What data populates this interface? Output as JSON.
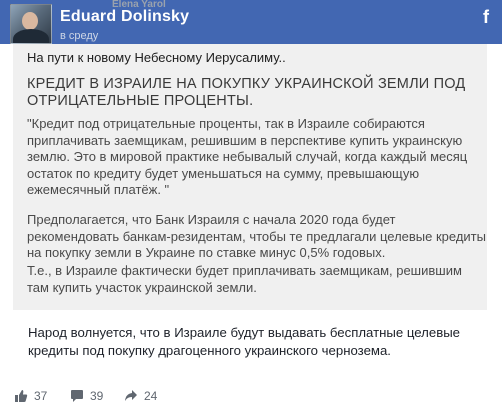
{
  "header": {
    "poster_name": "Eduard Dolinsky",
    "underlying_name": "Elena Yarol",
    "underlying_time": "в среду"
  },
  "shared": {
    "intro": "На пути к новому Небесному Иерусалиму..",
    "heading": "КРЕДИТ В ИЗРАИЛЕ НА ПОКУПКУ УКРАИНСКОЙ ЗЕМЛИ ПОД ОТРИЦАТЕЛЬНЫЕ ПРОЦЕНТЫ.",
    "quote": "\"Кредит под отрицательные проценты, так в Израиле собираются приплачивать заемщикам, решившим в перспективе купить украинскую землю. Это в мировой практике небывалый случай, когда каждый месяц остаток по кредиту будет уменьшаться на сумму, превышающую ежемесячный платёж. \"",
    "para2": "Предполагается, что Банк Израиля с начала 2020 года будет рекомендовать банкам-резидентам, чтобы те предлагали целевые кредиты на покупку земли в Украине по ставке минус 0,5% годовых.",
    "para3": "Т.е., в Израиле фактически будет приплачивать заемщикам, решившим там купить участок украинской земли."
  },
  "post": {
    "text": "Народ волнуется, что в Израиле будут выдавать бесплатные целевые кредиты под покупку драгоценного украинского чернозема."
  },
  "reactions": {
    "likes": "37",
    "comments": "39",
    "shares": "24"
  },
  "icons": {
    "facebook": "facebook-icon",
    "like": "like-icon",
    "comment": "comment-icon",
    "share": "share-icon"
  },
  "colors": {
    "header_bg": "#4267b2",
    "shared_bg": "#f0f0f0",
    "meta_text": "#606770"
  }
}
